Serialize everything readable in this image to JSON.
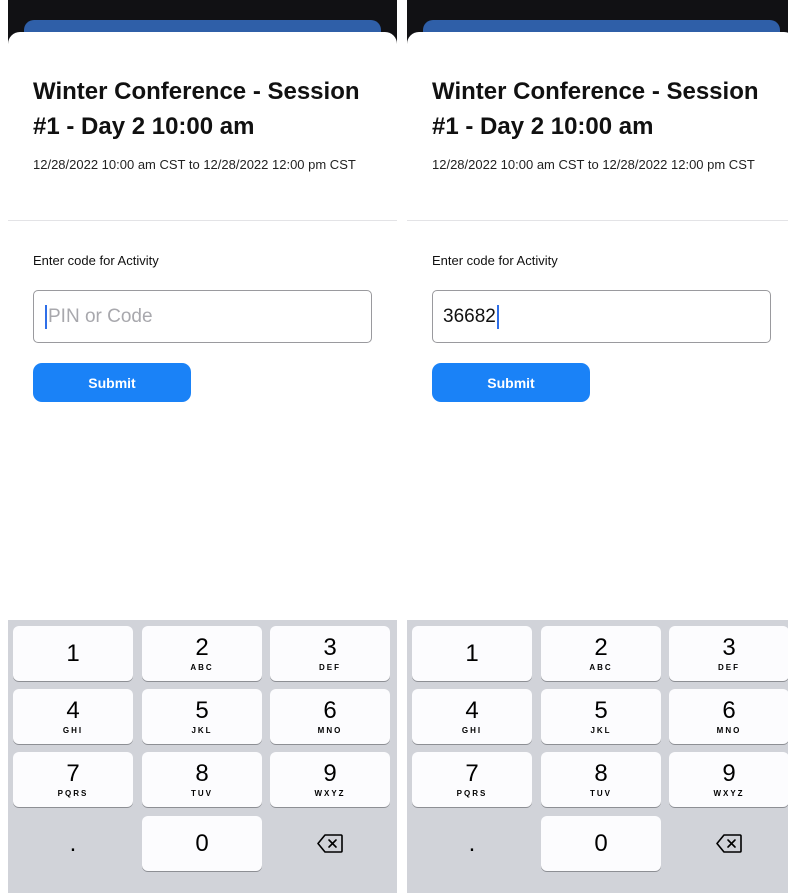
{
  "panels": [
    {
      "title": "Winter Conference - Session #1 - Day 2 10:00 am",
      "dates": "12/28/2022 10:00 am CST to 12/28/2022 12:00 pm CST",
      "label": "Enter code for Activity",
      "input_placeholder": "PIN or Code",
      "input_value": "",
      "submit_label": "Submit"
    },
    {
      "title": "Winter Conference - Session #1 - Day 2 10:00 am",
      "dates": "12/28/2022 10:00 am CST to 12/28/2022 12:00 pm CST",
      "label": "Enter code for Activity",
      "input_placeholder": "PIN or Code",
      "input_value": "36682",
      "submit_label": "Submit"
    }
  ],
  "keypad": {
    "keys": [
      {
        "digit": "1",
        "letters": ""
      },
      {
        "digit": "2",
        "letters": "ABC"
      },
      {
        "digit": "3",
        "letters": "DEF"
      },
      {
        "digit": "4",
        "letters": "GHI"
      },
      {
        "digit": "5",
        "letters": "JKL"
      },
      {
        "digit": "6",
        "letters": "MNO"
      },
      {
        "digit": "7",
        "letters": "PQRS"
      },
      {
        "digit": "8",
        "letters": "TUV"
      },
      {
        "digit": "9",
        "letters": "WXYZ"
      },
      {
        "digit": "0",
        "letters": ""
      }
    ],
    "dot": ".",
    "delete_icon": "delete-backspace-icon"
  }
}
